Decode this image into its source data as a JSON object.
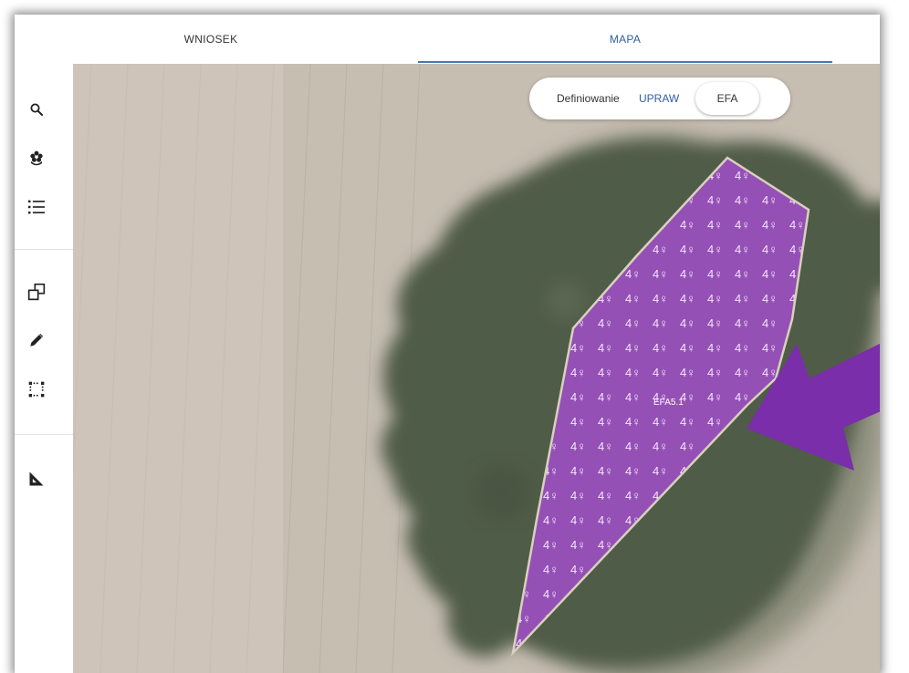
{
  "tabs": {
    "wniosek": "WNIOSEK",
    "mapa": "MAPA",
    "active": "MAPA"
  },
  "sidebar": {
    "tools": [
      {
        "icon": "search-icon"
      },
      {
        "icon": "flower-icon"
      },
      {
        "icon": "list-icon"
      },
      {
        "icon": "copy-shapes-icon"
      },
      {
        "icon": "pencil-icon"
      },
      {
        "icon": "select-area-icon"
      },
      {
        "icon": "ruler-square-icon"
      }
    ]
  },
  "map": {
    "mode": {
      "label": "Definiowanie",
      "option_upraw": "UPRAW",
      "option_efa": "EFA",
      "selected": "EFA"
    },
    "parcel": {
      "label": "EFA5.1",
      "pattern_glyph": "4♀",
      "fill_color": "#9b4fc0",
      "outline_color": "#d8d1bd"
    },
    "annotation_arrow_color": "#7a2eaa"
  },
  "colors": {
    "accent": "#2d5fa8",
    "field": "#c8bfb3",
    "trees": "#4e5a44"
  }
}
